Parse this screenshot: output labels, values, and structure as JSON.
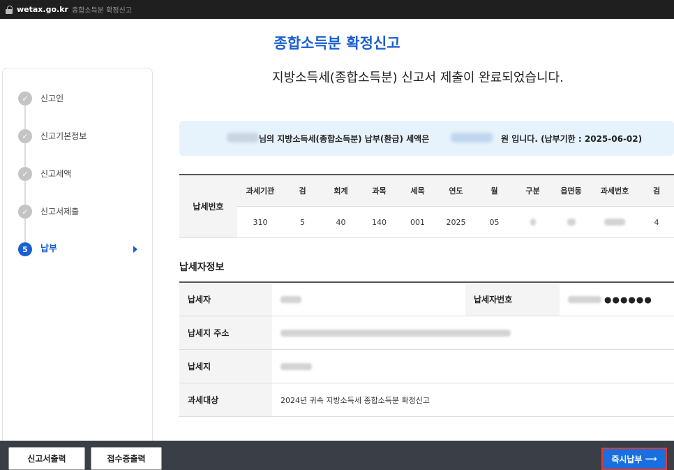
{
  "browser": {
    "domain": "wetax.go.kr",
    "page_title": "종합소득분 확정신고"
  },
  "header": {
    "title": "종합소득분 확정신고",
    "message": "지방소득세(종합소득분) 신고서 제출이 완료되었습니다."
  },
  "steps": [
    {
      "label": "신고인",
      "state": "done"
    },
    {
      "label": "신고기본정보",
      "state": "done"
    },
    {
      "label": "신고세액",
      "state": "done"
    },
    {
      "label": "신고서제출",
      "state": "done"
    },
    {
      "number": "5",
      "label": "납부",
      "state": "active"
    }
  ],
  "notice": {
    "text_before": "님의 지방소득세(종합소득분) 납부(환급) 세액은",
    "text_after": "원 입니다. (납부기한 : 2025-06-02)"
  },
  "tax_number": {
    "row_header": "납세번호",
    "columns": [
      "과세기관",
      "검",
      "회계",
      "과목",
      "세목",
      "연도",
      "월",
      "구분",
      "읍면동",
      "과세번호",
      "검"
    ],
    "values": [
      "310",
      "5",
      "40",
      "140",
      "001",
      "2025",
      "05",
      "",
      "",
      "",
      "4"
    ]
  },
  "taxpayer": {
    "section_title": "납세자정보",
    "rows": {
      "name_label": "납세자",
      "id_label": "납세자번호",
      "id_masked": "●●●●●●",
      "address_label": "납세지 주소",
      "place_label": "납세지",
      "subject_label": "과세대상",
      "subject_value": "2024년 귀속 지방소득세 종합소득분 확정신고"
    }
  },
  "footer": {
    "print_return": "신고서출력",
    "print_receipt": "접수증출력",
    "pay_now": "즉시납부"
  },
  "colors": {
    "primary": "#1a5fd0",
    "pay_button": "#1a6fe0",
    "highlight": "#e23b2e",
    "notice_bg": "#e6f2fc"
  }
}
